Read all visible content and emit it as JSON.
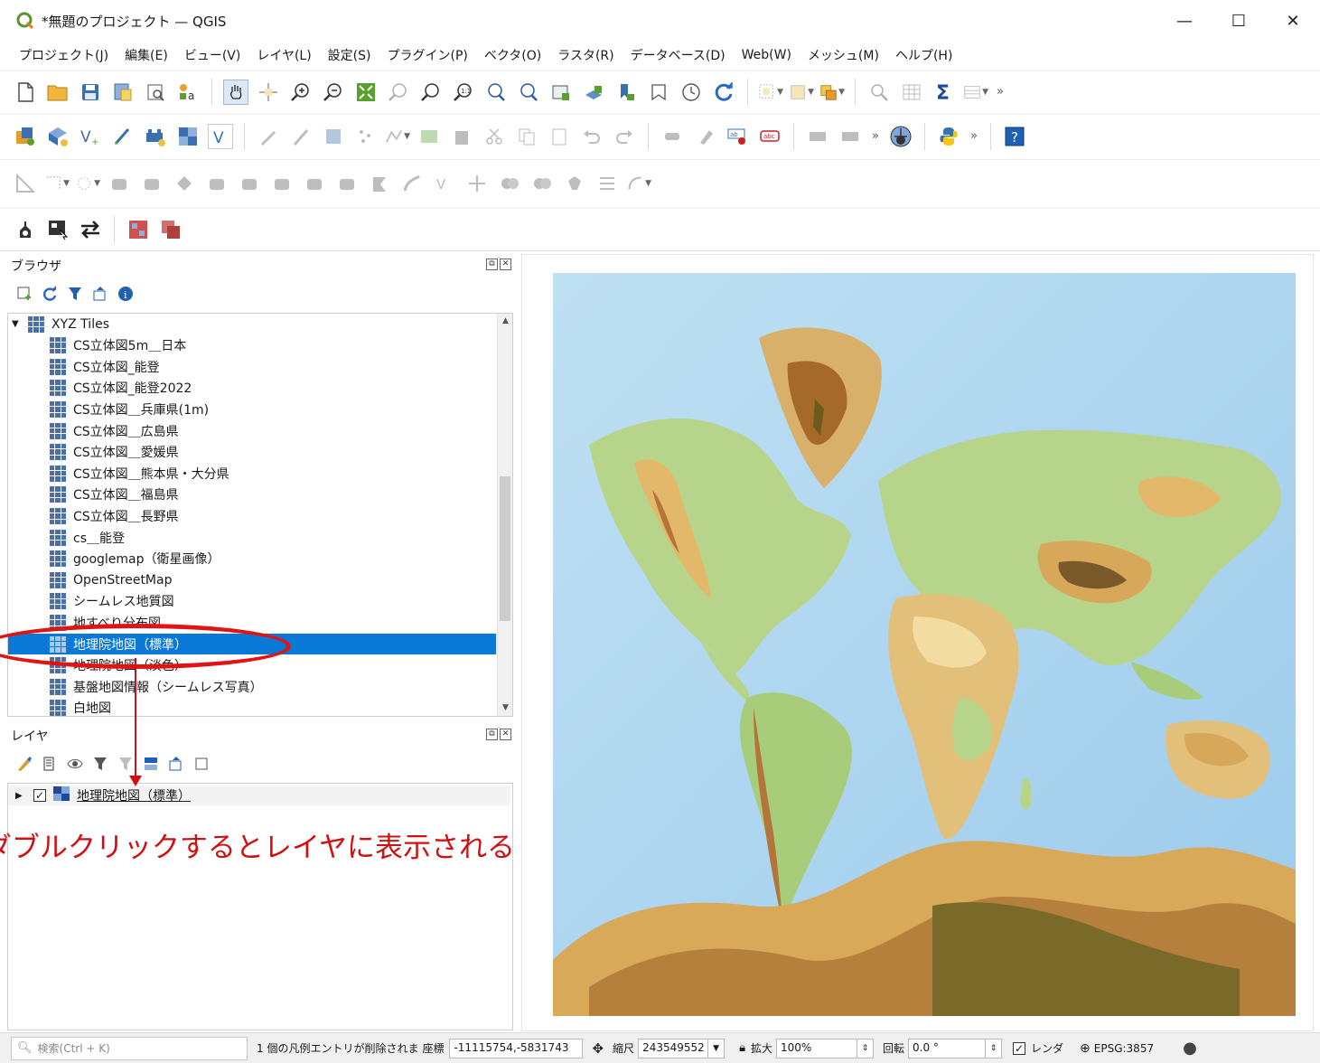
{
  "window": {
    "title": "*無題のプロジェクト — QGIS",
    "minimize": "—",
    "maximize": "☐",
    "close": "✕"
  },
  "menu": [
    "プロジェクト(J)",
    "編集(E)",
    "ビュー(V)",
    "レイヤ(L)",
    "設定(S)",
    "プラグイン(P)",
    "ベクタ(O)",
    "ラスタ(R)",
    "データベース(D)",
    "Web(W)",
    "メッシュ(M)",
    "ヘルプ(H)"
  ],
  "browser": {
    "title": "ブラウザ",
    "root": "XYZ Tiles",
    "items": [
      "CS立体図5m＿日本",
      "CS立体図_能登",
      "CS立体図_能登2022",
      "CS立体図＿兵庫県(1m)",
      "CS立体図＿広島県",
      "CS立体図＿愛媛県",
      "CS立体図＿熊本県・大分県",
      "CS立体図＿福島県",
      "CS立体図＿長野県",
      "cs＿能登",
      "googlemap（衛星画像）",
      "OpenStreetMap",
      "シームレス地質図",
      "地すべり分布図",
      "地理院地図（標準）",
      "地理院地図（淡色）",
      "基盤地図情報（シームレス写真）",
      "白地図"
    ],
    "selected_index": 14
  },
  "layers": {
    "title": "レイヤ",
    "items": [
      {
        "name": "地理院地図（標準）",
        "checked": true
      }
    ]
  },
  "annotation": {
    "text": "ダブルクリックするとレイヤに表示される",
    "color": "#d01010"
  },
  "statusbar": {
    "search_placeholder": "検索(Ctrl + K)",
    "message": "1 個の凡例エントリが削除されま",
    "coord_label": "座標",
    "coord_value": "-11115754,-5831743",
    "scale_label": "縮尺",
    "scale_value": "243549552",
    "magnify_label": "拡大",
    "magnify_value": "100%",
    "rotation_label": "回転",
    "rotation_value": "0.0 °",
    "render_label": "レンダ",
    "crs": "EPSG:3857"
  },
  "icons": [
    "qgis-logo-icon",
    "new-project-icon",
    "open-project-icon",
    "save-project-icon",
    "pan-icon",
    "zoom-in-icon",
    "zoom-out-icon",
    "refresh-icon",
    "sum-icon",
    "python-icon",
    "help-icon"
  ],
  "colors": {
    "selection": "#0a78d7",
    "accent": "#589632",
    "ocean": "#c7e3f4",
    "lowland": "#b9d58c",
    "highland": "#c48a48",
    "peak": "#7a5a2a"
  }
}
